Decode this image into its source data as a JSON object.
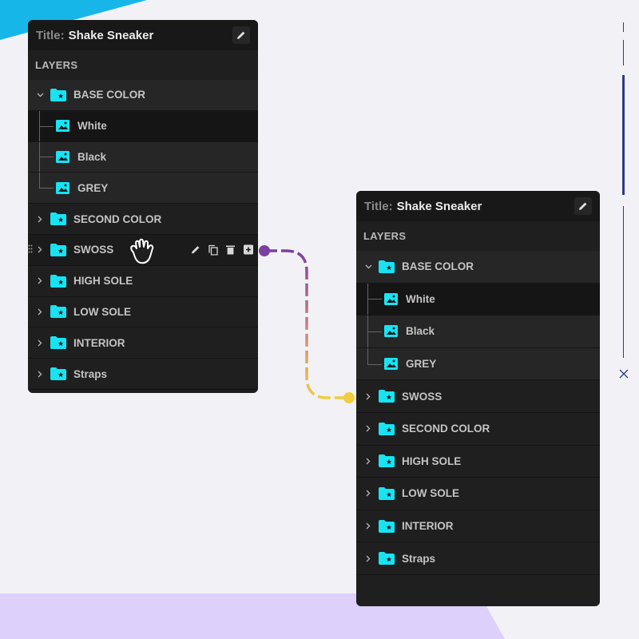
{
  "colors": {
    "accent_cyan": "#17e3f3",
    "connector_start": "#7a3fa0",
    "connector_end": "#f2cc3c",
    "panel_bg": "#1f1f1f"
  },
  "left_panel": {
    "title_prefix": "Title:",
    "title": "Shake Sneaker",
    "section_label": "LAYERS",
    "groups": [
      {
        "label": "BASE COLOR",
        "expanded": true
      },
      {
        "label": "White",
        "child": true,
        "selected": true
      },
      {
        "label": "Black",
        "child": true
      },
      {
        "label": "GREY",
        "child": true
      },
      {
        "label": "SECOND COLOR"
      },
      {
        "label": "SWOSS",
        "hovered": true
      },
      {
        "label": "HIGH SOLE"
      },
      {
        "label": "LOW SOLE"
      },
      {
        "label": "INTERIOR"
      },
      {
        "label": "Straps"
      }
    ]
  },
  "right_panel": {
    "title_prefix": "Title:",
    "title": "Shake Sneaker",
    "section_label": "LAYERS",
    "groups": [
      {
        "label": "BASE COLOR",
        "expanded": true
      },
      {
        "label": "White",
        "child": true,
        "selected": true
      },
      {
        "label": "Black",
        "child": true
      },
      {
        "label": "GREY",
        "child": true
      },
      {
        "label": "SWOSS"
      },
      {
        "label": "SECOND COLOR"
      },
      {
        "label": "HIGH SOLE"
      },
      {
        "label": "LOW SOLE"
      },
      {
        "label": "INTERIOR"
      },
      {
        "label": "Straps"
      }
    ]
  },
  "icons": {
    "edit": "pencil-icon",
    "duplicate": "copy-icon",
    "delete": "trash-icon",
    "add": "plus-icon",
    "drag": "drag-handle-icon",
    "folder": "folder-star-icon",
    "image": "image-icon",
    "cursor": "grab-hand-icon",
    "close": "close-icon"
  }
}
